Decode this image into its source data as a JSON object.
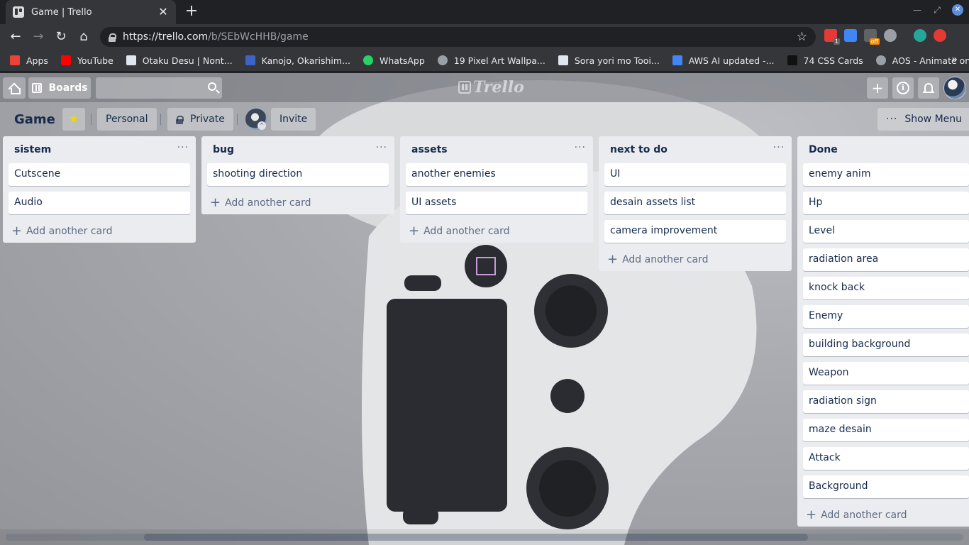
{
  "browser": {
    "tab_title": "Game | Trello",
    "tab_close": "✕",
    "new_tab": "+",
    "url_host": "https://trello.com",
    "url_path": "/b/SEbWcHHB/game",
    "extension_badges": [
      "1",
      "off"
    ],
    "bookmarks": [
      {
        "label": "Apps",
        "icon": "apps-grid-icon",
        "color": "#ea4335"
      },
      {
        "label": "YouTube",
        "icon": "youtube-icon",
        "color": "#ff0000"
      },
      {
        "label": "Otaku Desu | Nont...",
        "icon": "bookmark-page-icon",
        "color": "#dfe6f1"
      },
      {
        "label": "Kanojo, Okarishim...",
        "icon": "bookmark-page-icon",
        "color": "#3d63c9"
      },
      {
        "label": "WhatsApp",
        "icon": "whatsapp-icon",
        "color": "#25d366"
      },
      {
        "label": "19 Pixel Art Wallpa...",
        "icon": "globe-icon",
        "color": "#9aa0a6"
      },
      {
        "label": "Sora yori mo Tooi...",
        "icon": "bookmark-page-icon",
        "color": "#dfe6f1"
      },
      {
        "label": "AWS AI updated -...",
        "icon": "google-docs-icon",
        "color": "#4285f4"
      },
      {
        "label": "74 CSS Cards",
        "icon": "bookmark-page-icon",
        "color": "#111111"
      },
      {
        "label": "AOS - Animate on...",
        "icon": "globe-icon",
        "color": "#9aa0a6"
      }
    ],
    "bookmarks_more": "»"
  },
  "trello": {
    "boards_label": "Boards",
    "logo_text": "Trello",
    "create_label": "+",
    "board_title": "Game",
    "star_icon": "★",
    "team_label": "Personal",
    "visibility_label": "Private",
    "invite_label": "Invite",
    "show_menu_label": "Show Menu",
    "list_menu_glyph": "···",
    "add_card_label": "Add another card",
    "add_card_plus": "+",
    "lists": [
      {
        "title": "sistem",
        "cards": [
          "Cutscene",
          "Audio"
        ],
        "has_add": true
      },
      {
        "title": "bug",
        "cards": [
          "shooting direction"
        ],
        "has_add": true
      },
      {
        "title": "assets",
        "cards": [
          "another enemies",
          "UI assets"
        ],
        "has_add": true
      },
      {
        "title": "next to do",
        "cards": [
          "UI",
          "desain assets list",
          "camera improvement"
        ],
        "has_add": true
      },
      {
        "title": "Done",
        "cards": [
          "enemy anim",
          "Hp",
          "Level",
          "radiation area",
          "knock back",
          "Enemy",
          "building background",
          "Weapon",
          "radiation sign",
          "maze desain",
          "Attack",
          "Background"
        ],
        "has_add": true
      }
    ]
  },
  "colors": {
    "browser_dark": "#202124",
    "browser_toolbar": "#35363a",
    "list_bg": "#ebecf0",
    "text_dark": "#172b4d",
    "text_muted": "#5e6c84",
    "star_yellow": "#f2d600"
  }
}
